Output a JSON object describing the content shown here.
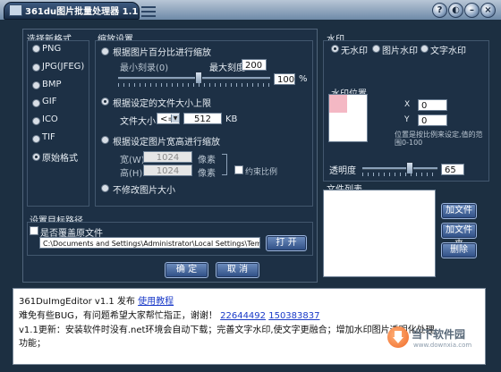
{
  "window": {
    "title": "361du图片批量处理器 1.1"
  },
  "window_controls": [
    {
      "name": "help-button",
      "glyph": "?"
    },
    {
      "name": "theme-button",
      "glyph": "◐"
    },
    {
      "name": "minimize-button",
      "glyph": "–"
    },
    {
      "name": "close-button",
      "glyph": "×"
    }
  ],
  "format": {
    "title": "选择新格式",
    "options": [
      "PNG",
      "JPG(JFEG)",
      "BMP",
      "GIF",
      "ICO",
      "TIF",
      "原始格式"
    ],
    "selected": "原始格式"
  },
  "resize": {
    "title": "缩放设置",
    "opt1": "根据图片百分比进行缩放",
    "min_label": "最小刻录(0)",
    "max_label": "最大刻度",
    "max_value": "200",
    "percent_value": "100",
    "percent_unit": "%",
    "opt2": "根据设定的文件大小上限",
    "filesize_label": "文件大小",
    "filesize_op": "<=",
    "filesize_value": "512",
    "filesize_unit": "KB",
    "opt3": "根据设定图片宽高进行缩放",
    "width_label": "宽(W)",
    "width_value": "1024",
    "height_label": "高(H)",
    "height_value": "1024",
    "px_unit": "像素",
    "keep_ratio": "约束比例",
    "opt4": "不修改图片大小",
    "selected": "根据设定的文件大小上限"
  },
  "target": {
    "title": "设置目标路径",
    "overwrite": "是否覆盖原文件",
    "path": "C:\\Documents and Settings\\Administrator\\Local Settings\\Temp\\",
    "open_btn": "打 开"
  },
  "actions": {
    "ok": "确 定",
    "cancel": "取 消"
  },
  "watermark": {
    "title": "水印",
    "options": [
      "无水印",
      "图片水印",
      "文字水印"
    ],
    "selected": "无水印",
    "pos_title": "水印位置",
    "x_label": "X",
    "x_value": "0",
    "y_label": "Y",
    "y_value": "0",
    "hint": "位置是按比例来设定,值的范围0-100",
    "opacity_label": "透明度",
    "opacity_value": "65",
    "accent": "#f4b8c4"
  },
  "filelist": {
    "title": "文件列表",
    "add_file": "加文件",
    "add_folder": "加文件夹",
    "delete": "删除"
  },
  "log": {
    "line1_prefix": "361DuImgEditor v1.1 发布",
    "line1_link": "使用教程",
    "line2_text": "难免有些BUG，有问题希望大家帮忙指正，谢谢！",
    "line2_link1": "22644492",
    "line2_link2": "150383837",
    "line3": "v1.1更新：安装软件时没有.net环境会自动下载；完善文字水印,使文字更融合；增加水印图片透明化处理",
    "line4": "功能；"
  },
  "watermark_logo": {
    "text": "当下软件园",
    "sub": "www.downxia.com"
  }
}
